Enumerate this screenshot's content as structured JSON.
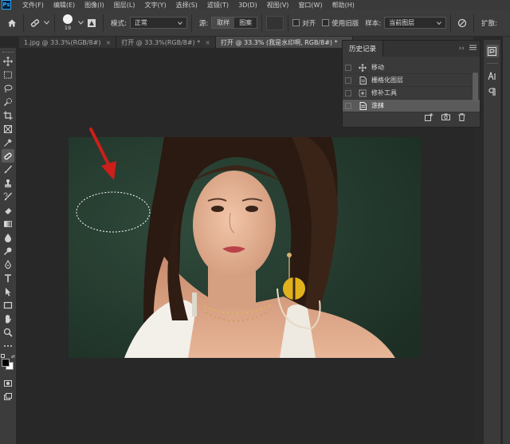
{
  "menubar": {
    "logo": "Ps",
    "items": [
      "文件(F)",
      "编辑(E)",
      "图像(I)",
      "图层(L)",
      "文字(Y)",
      "选择(S)",
      "滤镜(T)",
      "3D(D)",
      "视图(V)",
      "窗口(W)",
      "帮助(H)"
    ]
  },
  "options": {
    "brush_size": "19",
    "mode_label": "模式:",
    "mode_value": "正常",
    "source_label": "源:",
    "source_sample": "取样",
    "source_pattern": "图案",
    "aligned_label": "对齐",
    "legacy_label": "使用旧版",
    "sample_label": "样本:",
    "sample_value": "当前图层",
    "diffusion_label": "扩散:"
  },
  "tabs": [
    {
      "label": "1.jpg @ 33.3%(RGB/8#)",
      "close": "×"
    },
    {
      "label": "打开 @ 33.3%(RGB/8#) *",
      "close": "×"
    },
    {
      "label": "打开 @ 33.3% (我是水印啊, RGB/8#) *",
      "close": "×"
    }
  ],
  "history": {
    "title": "历史记录",
    "items": [
      {
        "label": "移动",
        "icon": "move-icon"
      },
      {
        "label": "栅格化图层",
        "icon": "document-icon"
      },
      {
        "label": "修补工具",
        "icon": "patch-icon"
      },
      {
        "label": "涂抹",
        "icon": "document-icon",
        "active": true
      }
    ],
    "footer_icons": [
      "new-document-from-state-icon",
      "camera-snapshot-icon",
      "trash-icon"
    ]
  },
  "colors": {
    "accent_arrow": "#cc1f1a",
    "app_bg": "#282828",
    "panel_bg": "#3a3a3a",
    "active_row": "#5a5a5a"
  }
}
